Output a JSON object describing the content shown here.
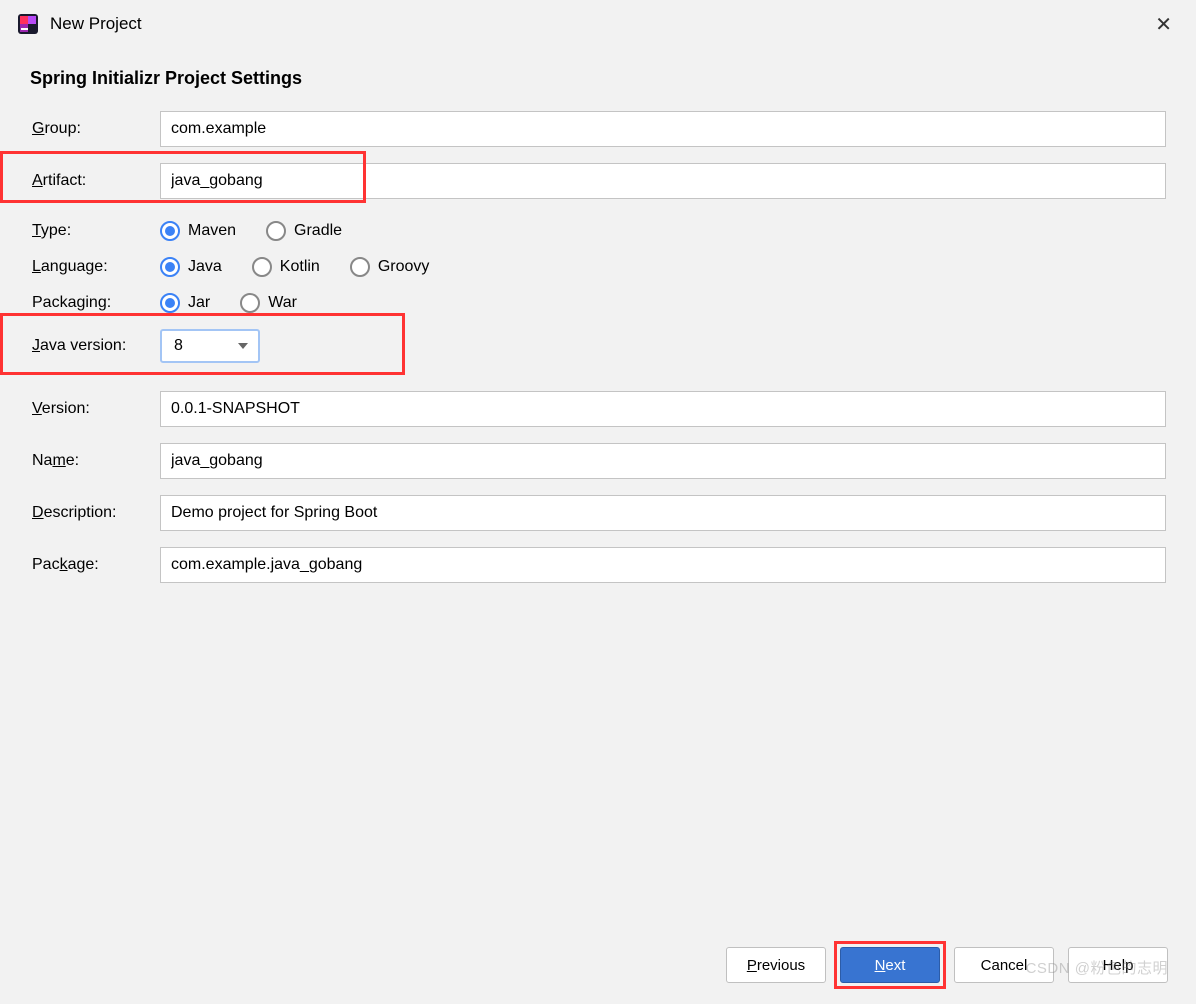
{
  "window": {
    "title": "New Project"
  },
  "heading": "Spring Initializr Project Settings",
  "fields": {
    "group_label": "Group:",
    "group_value": "com.example",
    "artifact_label": "Artifact:",
    "artifact_value": "java_gobang",
    "type_label": "Type:",
    "type_options": {
      "maven": "Maven",
      "gradle": "Gradle"
    },
    "type_selected": "maven",
    "language_label": "Language:",
    "language_options": {
      "java": "Java",
      "kotlin": "Kotlin",
      "groovy": "Groovy"
    },
    "language_selected": "java",
    "packaging_label": "Packaging:",
    "packaging_options": {
      "jar": "Jar",
      "war": "War"
    },
    "packaging_selected": "jar",
    "java_version_label": "Java version:",
    "java_version_value": "8",
    "version_label": "Version:",
    "version_value": "0.0.1-SNAPSHOT",
    "name_label": "Name:",
    "name_value": "java_gobang",
    "description_label": "Description:",
    "description_value": "Demo project for Spring Boot",
    "package_label": "Package:",
    "package_value": "com.example.java_gobang"
  },
  "buttons": {
    "previous": "Previous",
    "next": "Next",
    "cancel": "Cancel",
    "help": "Help"
  },
  "watermark": "CSDN @粉色的志明"
}
